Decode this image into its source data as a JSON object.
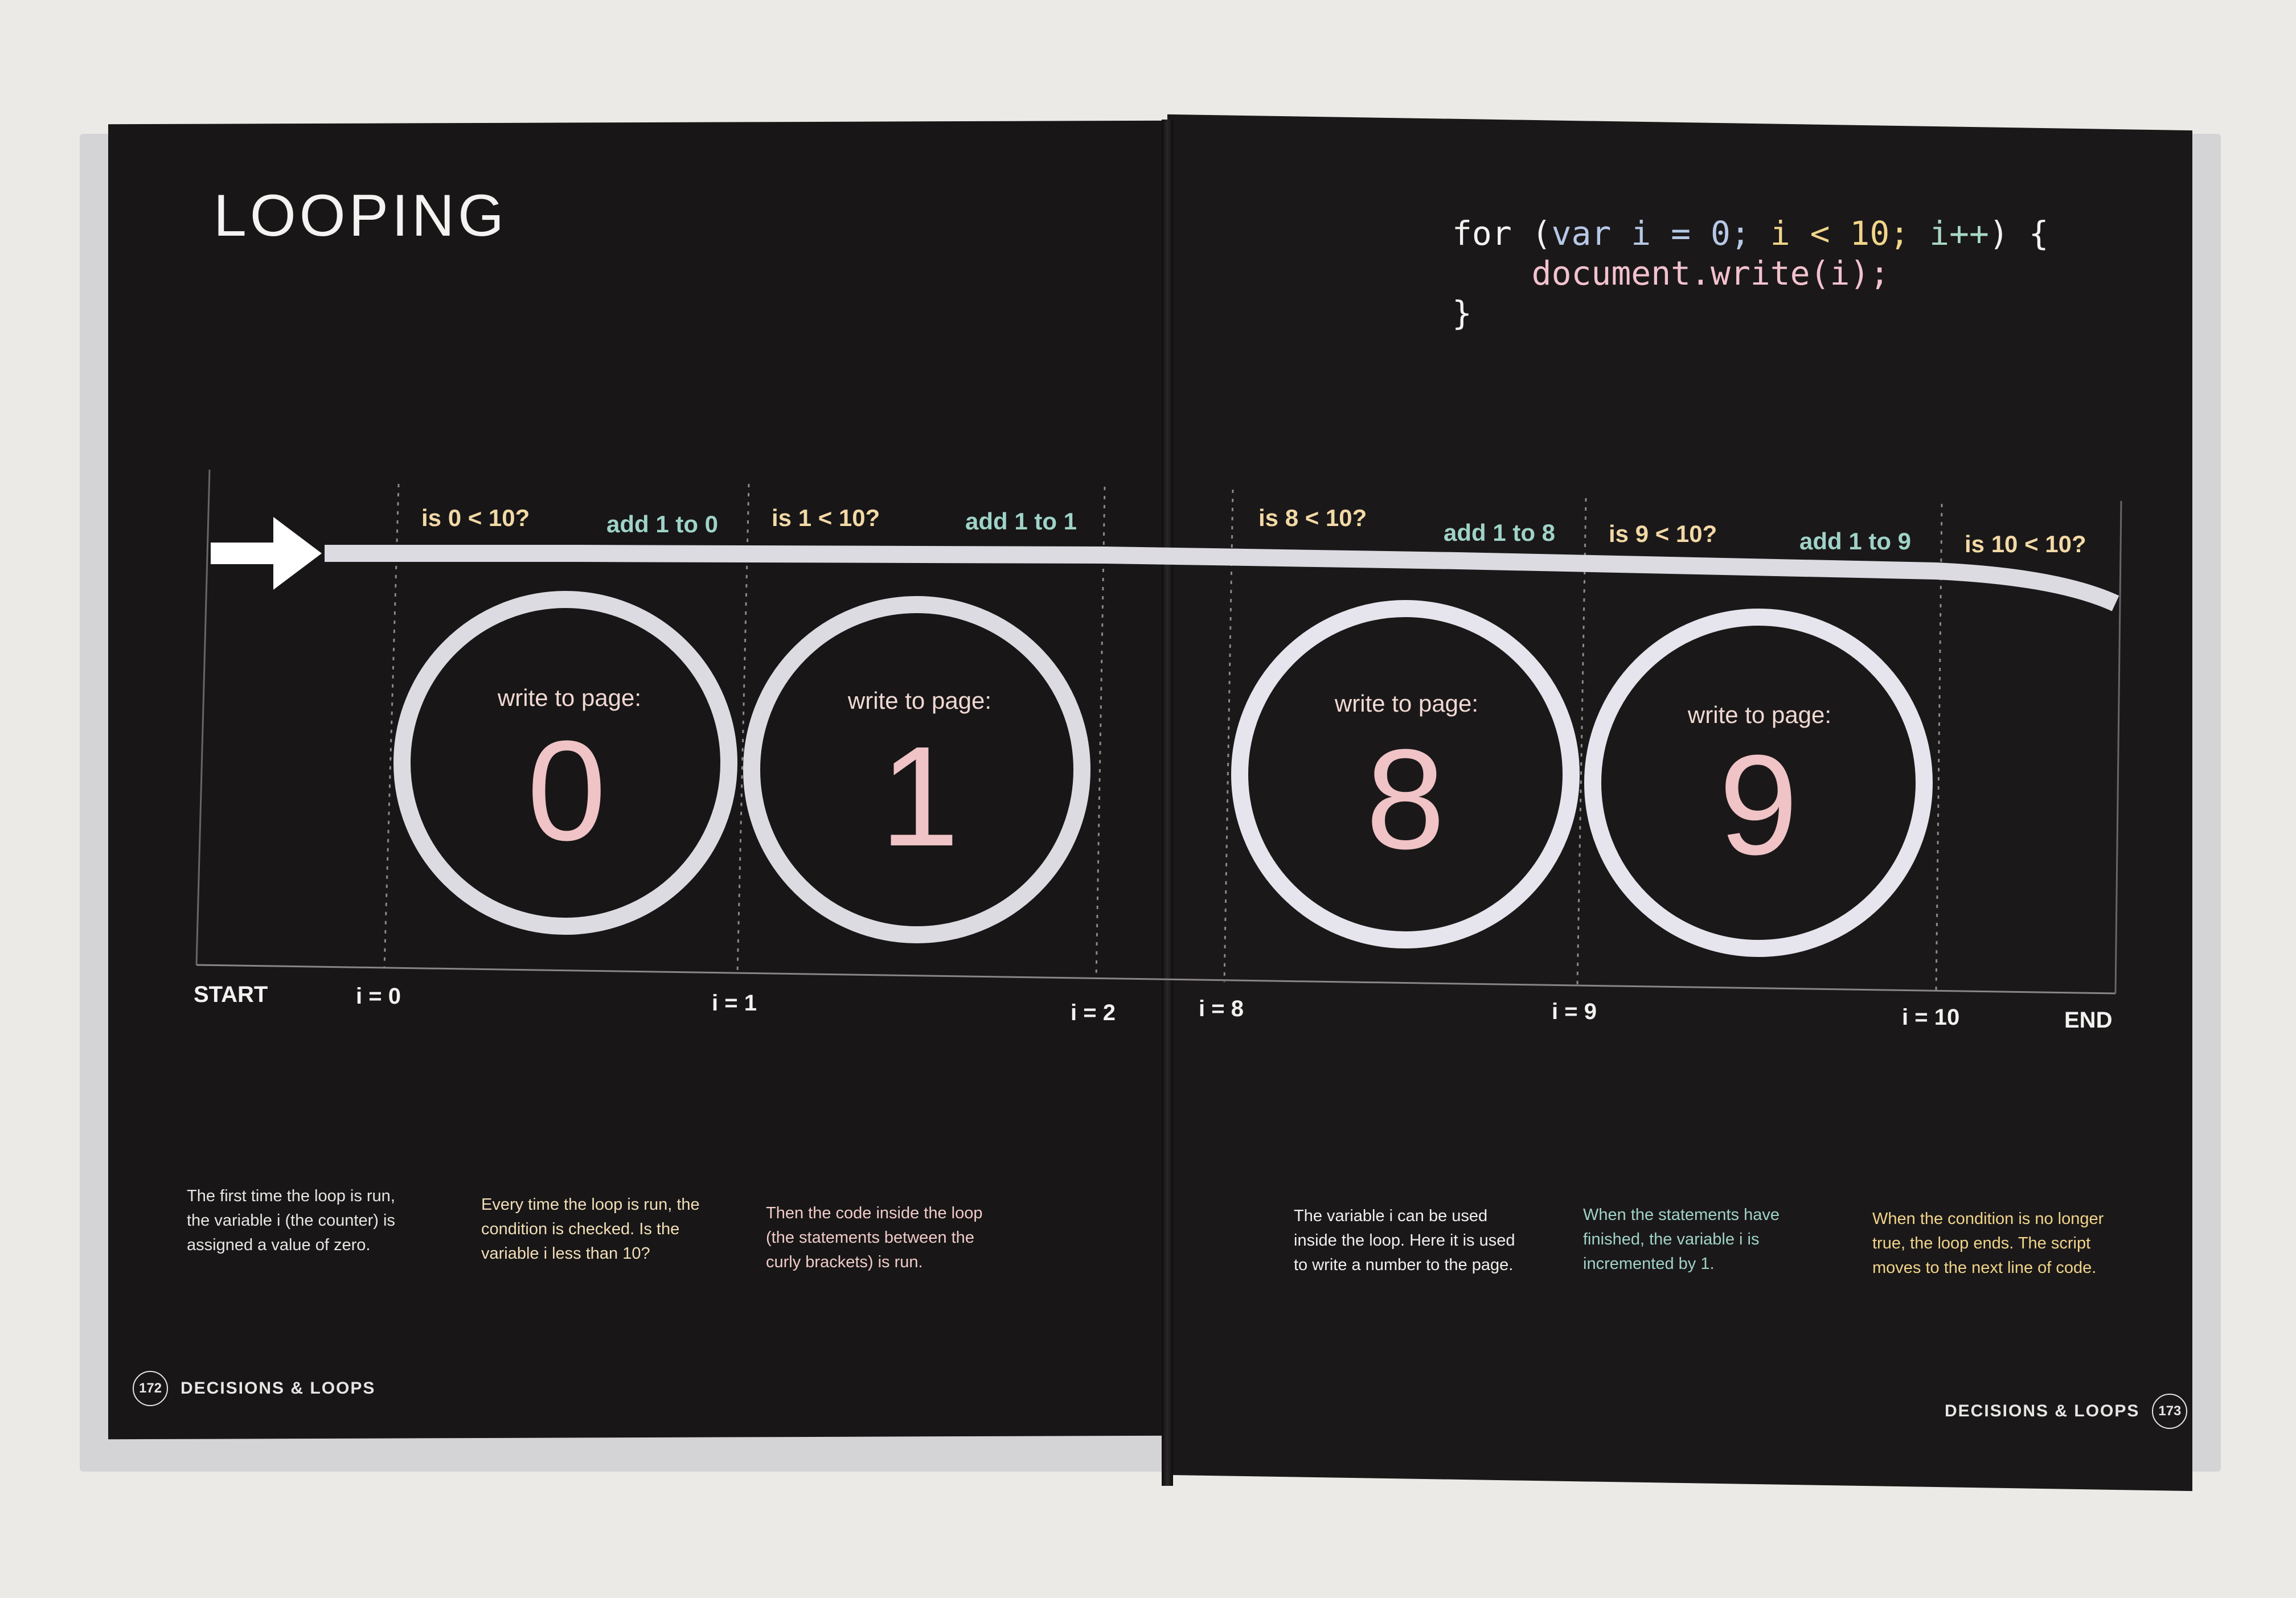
{
  "spread": {
    "heading": "LOOPING",
    "code_lines": [
      {
        "kw": "for",
        "open": " (",
        "var": "var i",
        "eq": " = 0;",
        "cond": " i < 10;",
        "inc": " i++",
        "close": ") {"
      },
      {
        "body": "    document.write(i);"
      },
      {
        "end": "}"
      }
    ]
  },
  "diagram": {
    "conditions": [
      {
        "label": "is 0 < 10?",
        "color": "#f2d9a6"
      },
      {
        "label": "is 1 < 10?",
        "color": "#f2d9a6"
      },
      {
        "label": "is 8 < 10?",
        "color": "#f2d9a6"
      },
      {
        "label": "is 9 < 10?",
        "color": "#f2d9a6"
      },
      {
        "label": "is 10 < 10?",
        "color": "#f2d9a6"
      }
    ],
    "increments": [
      {
        "label": "add 1 to 0",
        "color": "#9fd3c7"
      },
      {
        "label": "add 1 to 1",
        "color": "#9fd3c7"
      },
      {
        "label": "add 1 to 8",
        "color": "#9fd3c7"
      },
      {
        "label": "add 1 to 9",
        "color": "#9fd3c7"
      }
    ],
    "loops": [
      {
        "caption": "write to page:",
        "value": "0"
      },
      {
        "caption": "write to page:",
        "value": "1"
      },
      {
        "caption": "write to page:",
        "value": "8"
      },
      {
        "caption": "write to page:",
        "value": "9"
      }
    ],
    "axis": {
      "start": "START",
      "end": "END",
      "ticks": [
        "i = 0",
        "i = 1",
        "i = 2",
        "i = 8",
        "i = 9",
        "i = 10"
      ]
    },
    "colors": {
      "track": "#dcdbe2",
      "caption": "#f0d9d2",
      "digit": "#f0c3c6",
      "arrow": "#ffffff"
    }
  },
  "descriptions": [
    {
      "text": "The first time the loop is run, the variable i (the counter) is assigned a value of zero.",
      "color": "#e8e6e3"
    },
    {
      "text": "Every time the loop is run, the condition is checked. Is the variable i less than 10?",
      "color": "#f2dfb8"
    },
    {
      "text": "Then the code inside the loop (the statements between the curly brackets) is run.",
      "color": "#f0cbc8"
    },
    {
      "text": "The variable i can be used inside the loop. Here it is used to write a number to the page.",
      "color": "#f1f0ee"
    },
    {
      "text": "When the statements have finished, the variable i is incremented by 1.",
      "color": "#9fd3c7"
    },
    {
      "text": "When the condition is no longer true, the loop ends. The script moves to the next line of code.",
      "color": "#f0d58a"
    }
  ],
  "folios": [
    {
      "number": "172",
      "title": "DECISIONS & LOOPS"
    },
    {
      "number": "173",
      "title": "DECISIONS & LOOPS"
    }
  ]
}
